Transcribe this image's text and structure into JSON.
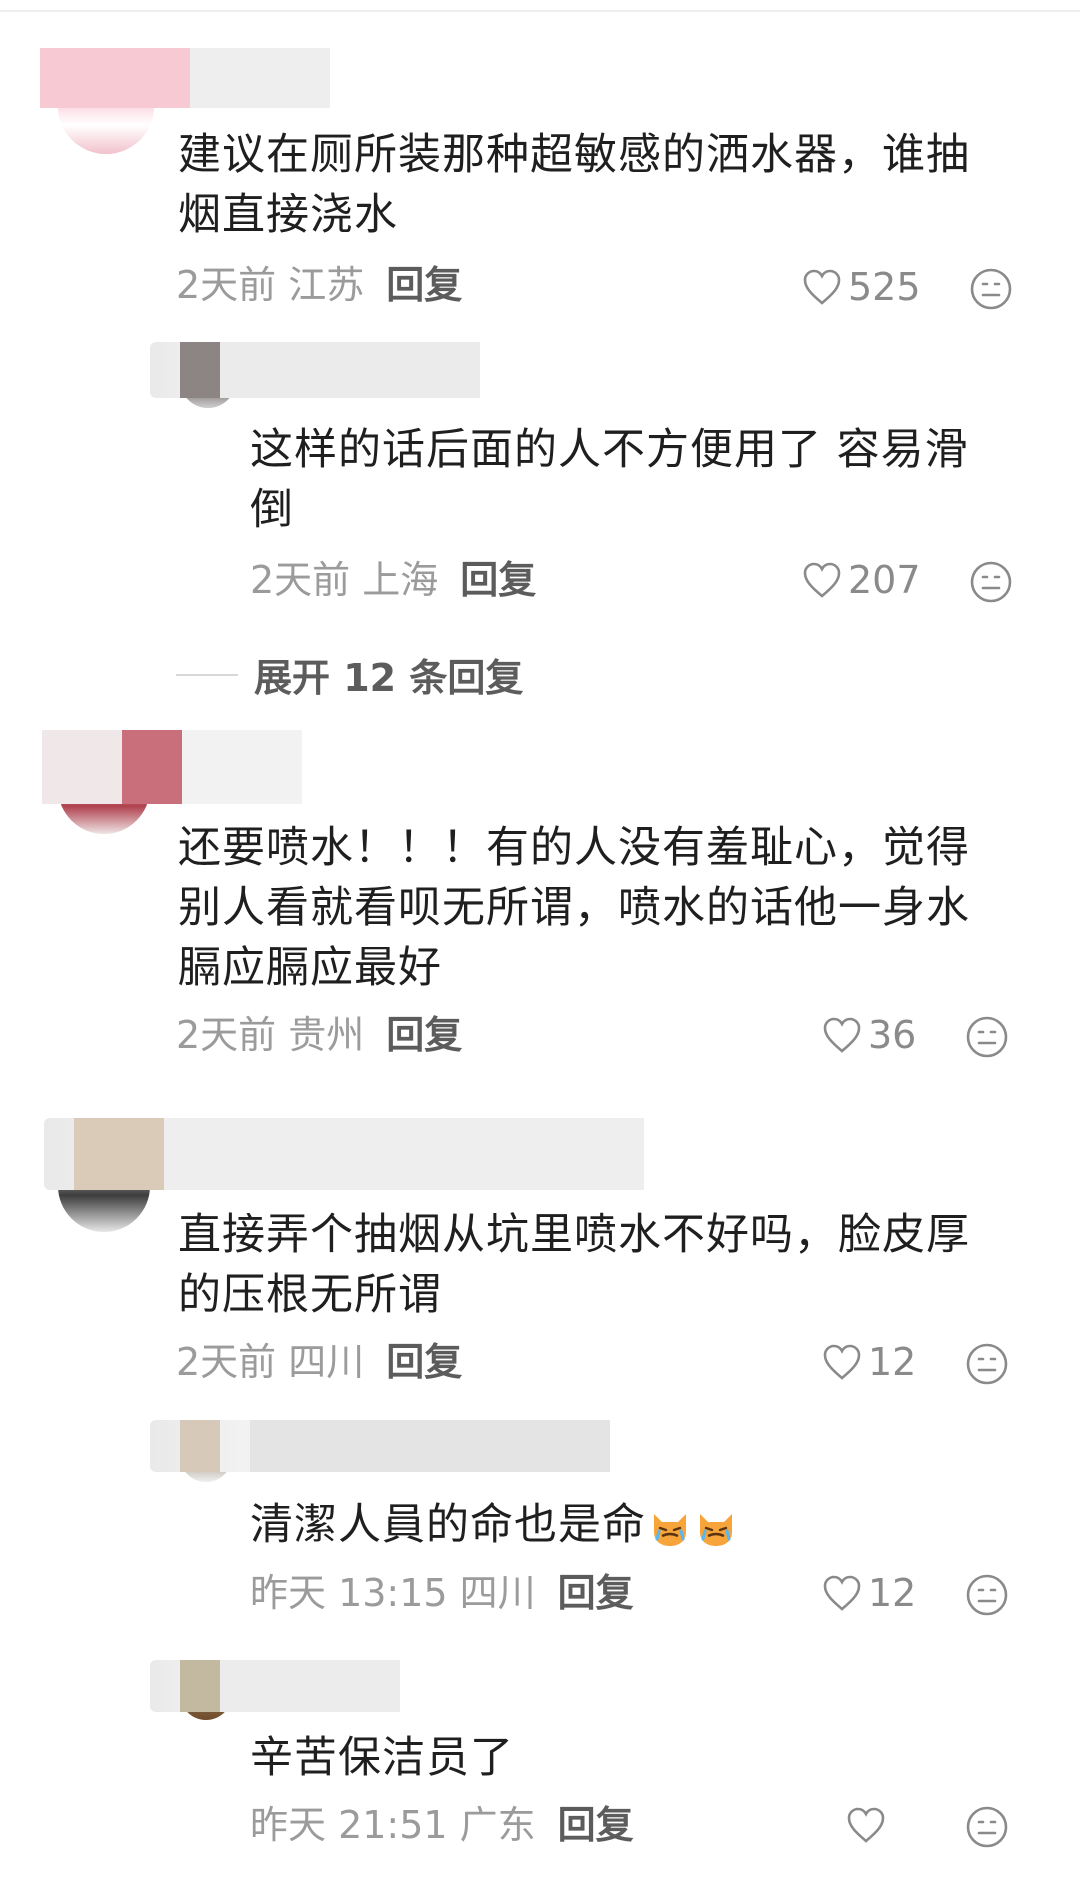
{
  "comments": [
    {
      "content": "建议在厕所装那种超敏感的洒水器，谁抽烟直接浇水",
      "time": "2天前",
      "region": "江苏",
      "reply_label": "回复",
      "likes": "525",
      "replies": [
        {
          "content": "这样的话后面的人不方便用了 容易滑倒",
          "time": "2天前",
          "region": "上海",
          "reply_label": "回复",
          "likes": "207"
        }
      ],
      "expand_label": "展开 12 条回复"
    },
    {
      "content": "还要喷水！！！有的人没有羞耻心，觉得别人看就看呗无所谓，喷水的话他一身水膈应膈应最好",
      "time": "2天前",
      "region": "贵州",
      "reply_label": "回复",
      "likes": "36"
    },
    {
      "content": "直接弄个抽烟从坑里喷水不好吗，脸皮厚的压根无所谓",
      "time": "2天前",
      "region": "四川",
      "reply_label": "回复",
      "likes": "12",
      "replies": [
        {
          "content": "清潔人員的命也是命",
          "emoji": "crying-cat-emoji",
          "time": "昨天 13:15",
          "region": "四川",
          "reply_label": "回复",
          "likes": "12"
        },
        {
          "content": "辛苦保洁员了",
          "time": "昨天 21:51",
          "region": "广东",
          "reply_label": "回复",
          "likes": ""
        }
      ]
    }
  ],
  "icons": {
    "like": "heart-outline-icon",
    "dislike": "neutral-face-icon"
  },
  "colors": {
    "text": "#1f1f1f",
    "meta": "#9b9b9b",
    "reply": "#5c5c5c"
  }
}
